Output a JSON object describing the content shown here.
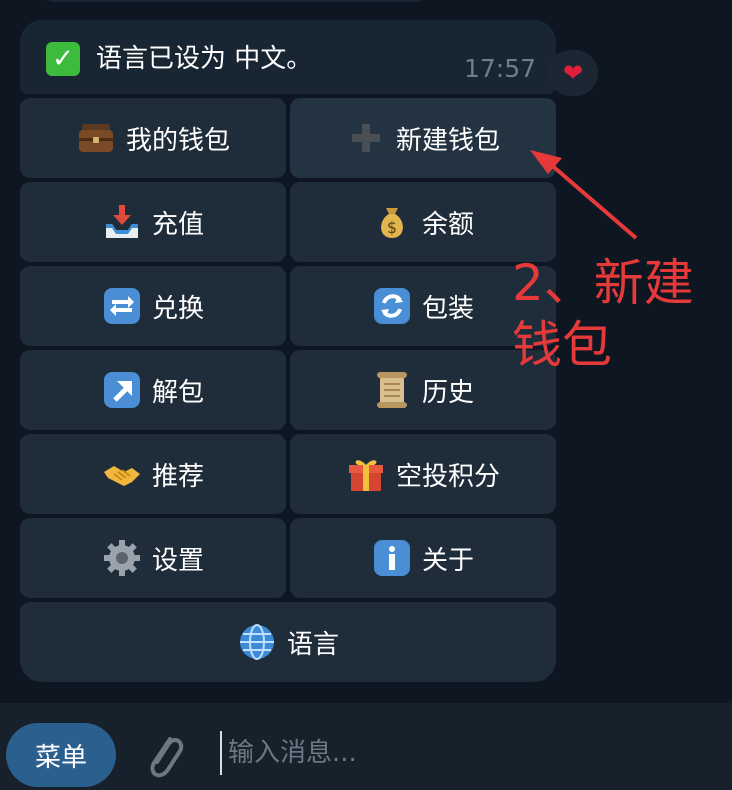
{
  "message": {
    "check_glyph": "✓",
    "text": "语言已设为 中文。",
    "time": "17:57",
    "reaction": "❤"
  },
  "keyboard": {
    "buttons": [
      {
        "label": "我的钱包",
        "icon": "briefcase-icon"
      },
      {
        "label": "新建钱包",
        "icon": "plus-icon"
      },
      {
        "label": "充值",
        "icon": "inbox-tray-icon"
      },
      {
        "label": "余额",
        "icon": "money-bag-icon"
      },
      {
        "label": "兑换",
        "icon": "repeat-icon"
      },
      {
        "label": "包装",
        "icon": "refresh-icon"
      },
      {
        "label": "解包",
        "icon": "up-right-arrow-icon"
      },
      {
        "label": "历史",
        "icon": "scroll-icon"
      },
      {
        "label": "推荐",
        "icon": "handshake-icon"
      },
      {
        "label": "空投积分",
        "icon": "gift-icon"
      },
      {
        "label": "设置",
        "icon": "gear-icon"
      },
      {
        "label": "关于",
        "icon": "info-icon"
      },
      {
        "label": "语言",
        "icon": "globe-icon"
      }
    ]
  },
  "annotation": {
    "text": "2、新建\n钱包",
    "color": "#e63a3a"
  },
  "bottom": {
    "menu_label": "菜单",
    "input_placeholder": "输入消息..."
  },
  "colors": {
    "background": "#0e1621",
    "bubble": "#182533",
    "button": "#1f2c3a",
    "menu_button": "#2b5f8e",
    "check": "#3dbb3d"
  }
}
